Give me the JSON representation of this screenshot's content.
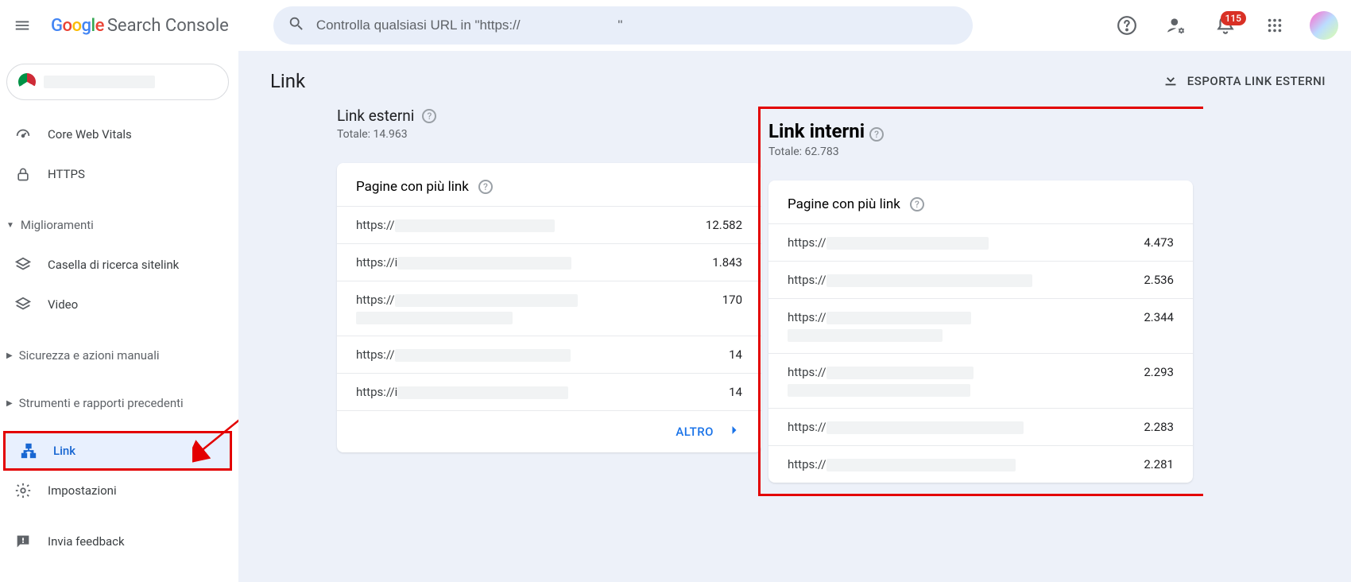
{
  "header": {
    "logo_brand_chars": [
      "G",
      "o",
      "o",
      "g",
      "l",
      "e"
    ],
    "product": "Search Console",
    "search_placeholder_prefix": "Controlla qualsiasi URL in \"https://",
    "search_placeholder_suffix": "\"",
    "notifications_count": "115"
  },
  "sidebar": {
    "items_top": [
      {
        "label": "Core Web Vitals",
        "icon": "speed"
      },
      {
        "label": "HTTPS",
        "icon": "lock"
      }
    ],
    "sections": [
      {
        "label": "Miglioramenti",
        "expanded": true,
        "items": [
          {
            "label": "Casella di ricerca sitelink",
            "icon": "layers"
          },
          {
            "label": "Video",
            "icon": "layers"
          }
        ]
      },
      {
        "label": "Sicurezza e azioni manuali",
        "expanded": false
      },
      {
        "label": "Strumenti e rapporti precedenti",
        "expanded": false
      }
    ],
    "link_label": "Link",
    "settings_label": "Impostazioni",
    "feedback_label": "Invia feedback"
  },
  "page": {
    "title": "Link",
    "export_label": "ESPORTA LINK ESTERNI"
  },
  "external": {
    "heading": "Link esterni",
    "total_label": "Totale: 14.963",
    "card_title": "Pagine con più link",
    "rows": [
      {
        "prefix": "https://",
        "value": "12.582"
      },
      {
        "prefix": "https://i",
        "value": "1.843"
      },
      {
        "prefix": "https://",
        "value": "170",
        "twoLine": true
      },
      {
        "prefix": "https://",
        "value": "14"
      },
      {
        "prefix": "https://i",
        "value": "14"
      }
    ],
    "more": "ALTRO"
  },
  "internal": {
    "heading": "Link interni",
    "total_label": "Totale: 62.783",
    "card_title": "Pagine con più link",
    "rows": [
      {
        "prefix": "https://",
        "value": "4.473"
      },
      {
        "prefix": "https://",
        "value": "2.536"
      },
      {
        "prefix": "https://",
        "value": "2.344",
        "twoLine": true
      },
      {
        "prefix": "https://",
        "value": "2.293",
        "twoLine": true
      },
      {
        "prefix": "https://",
        "value": "2.283"
      },
      {
        "prefix": "https://",
        "value": "2.281"
      }
    ]
  }
}
